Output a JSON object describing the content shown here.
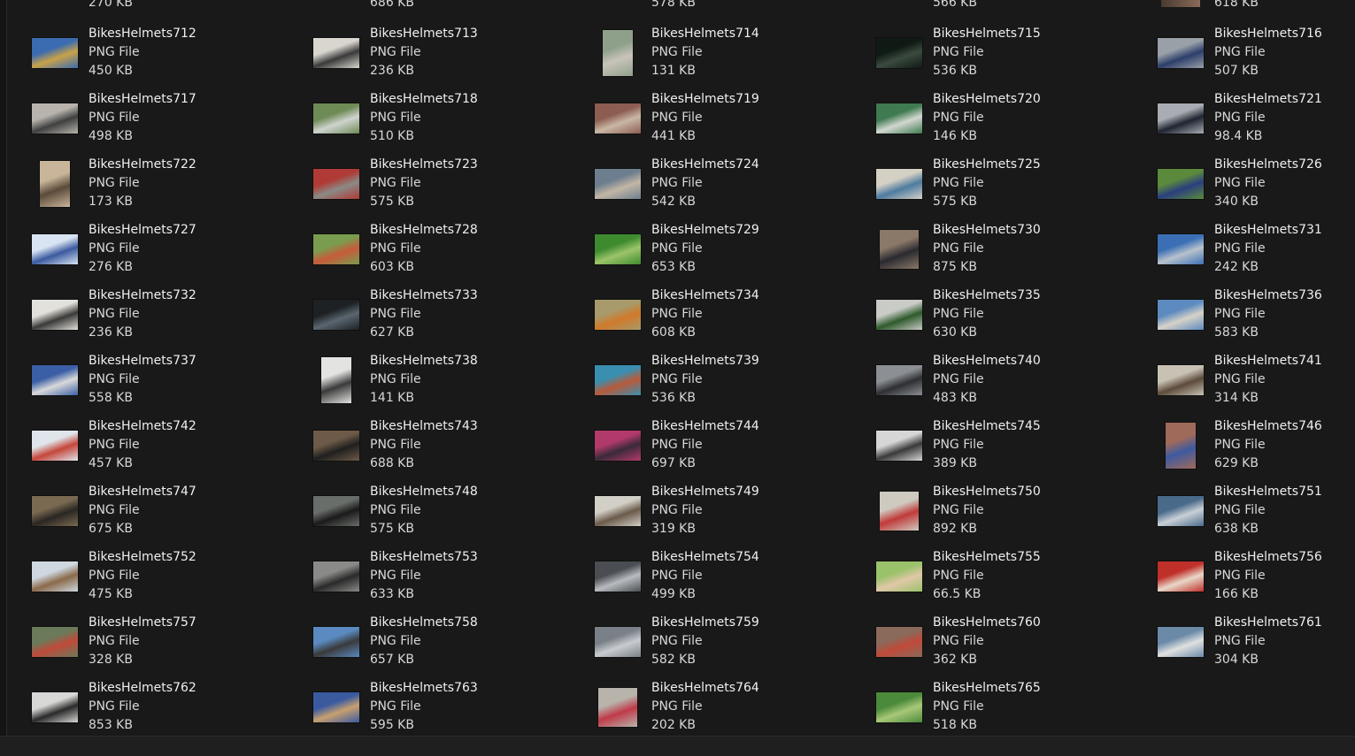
{
  "partial_row": [
    "270 KB",
    "686 KB",
    "578 KB",
    "566 KB",
    "618 KB"
  ],
  "file_type": "PNG File",
  "files": [
    {
      "name": "BikesHelmets712",
      "size": "450 KB",
      "shape": "land",
      "colors": [
        "#3b6bb0",
        "#c8a24a"
      ]
    },
    {
      "name": "BikesHelmets713",
      "size": "236 KB",
      "shape": "land",
      "colors": [
        "#d9d6cf",
        "#3a3a3a"
      ]
    },
    {
      "name": "BikesHelmets714",
      "size": "131 KB",
      "shape": "port",
      "colors": [
        "#8fa08a",
        "#c9c4bb"
      ]
    },
    {
      "name": "BikesHelmets715",
      "size": "536 KB",
      "shape": "land",
      "colors": [
        "#0f1a14",
        "#3b4a3e"
      ]
    },
    {
      "name": "BikesHelmets716",
      "size": "507 KB",
      "shape": "land",
      "colors": [
        "#9aa0a8",
        "#2c3e6a"
      ]
    },
    {
      "name": "BikesHelmets717",
      "size": "498 KB",
      "shape": "land",
      "colors": [
        "#b8b4ad",
        "#3f4040"
      ]
    },
    {
      "name": "BikesHelmets718",
      "size": "510 KB",
      "shape": "land",
      "colors": [
        "#6e8a55",
        "#cfd3cf"
      ]
    },
    {
      "name": "BikesHelmets719",
      "size": "441 KB",
      "shape": "land",
      "colors": [
        "#8d5c52",
        "#c9b7a4"
      ]
    },
    {
      "name": "BikesHelmets720",
      "size": "146 KB",
      "shape": "land",
      "colors": [
        "#3f7a50",
        "#d2d7d0"
      ]
    },
    {
      "name": "BikesHelmets721",
      "size": "98.4 KB",
      "shape": "land",
      "colors": [
        "#a9adb3",
        "#1e2430"
      ]
    },
    {
      "name": "BikesHelmets722",
      "size": "173 KB",
      "shape": "port",
      "colors": [
        "#c9b59a",
        "#5a4a3a"
      ]
    },
    {
      "name": "BikesHelmets723",
      "size": "575 KB",
      "shape": "land",
      "colors": [
        "#b03a35",
        "#8a8a86"
      ]
    },
    {
      "name": "BikesHelmets724",
      "size": "542 KB",
      "shape": "land",
      "colors": [
        "#6d7f8e",
        "#c3b6a5"
      ]
    },
    {
      "name": "BikesHelmets725",
      "size": "575 KB",
      "shape": "land",
      "colors": [
        "#d5d0c4",
        "#4d7ba0"
      ]
    },
    {
      "name": "BikesHelmets726",
      "size": "340 KB",
      "shape": "land",
      "colors": [
        "#5c8a3c",
        "#2a3f7e"
      ]
    },
    {
      "name": "BikesHelmets727",
      "size": "276 KB",
      "shape": "land",
      "colors": [
        "#d9e4f2",
        "#3b5aa0"
      ]
    },
    {
      "name": "BikesHelmets728",
      "size": "603 KB",
      "shape": "land",
      "colors": [
        "#7a9c4e",
        "#c75b3a"
      ]
    },
    {
      "name": "BikesHelmets729",
      "size": "653 KB",
      "shape": "land",
      "colors": [
        "#3e8a2f",
        "#9cc46a"
      ]
    },
    {
      "name": "BikesHelmets730",
      "size": "875 KB",
      "shape": "sq",
      "colors": [
        "#8a7868",
        "#2a2a30"
      ]
    },
    {
      "name": "BikesHelmets731",
      "size": "242 KB",
      "shape": "land",
      "colors": [
        "#3b6fb5",
        "#b8c2cc"
      ]
    },
    {
      "name": "BikesHelmets732",
      "size": "236 KB",
      "shape": "land",
      "colors": [
        "#e3e1dc",
        "#3a3a38"
      ]
    },
    {
      "name": "BikesHelmets733",
      "size": "627 KB",
      "shape": "land",
      "colors": [
        "#1d2124",
        "#5a6670"
      ]
    },
    {
      "name": "BikesHelmets734",
      "size": "608 KB",
      "shape": "land",
      "colors": [
        "#a89a6a",
        "#d07a2a"
      ]
    },
    {
      "name": "BikesHelmets735",
      "size": "630 KB",
      "shape": "land",
      "colors": [
        "#c9cbc6",
        "#2e5a2c"
      ]
    },
    {
      "name": "BikesHelmets736",
      "size": "583 KB",
      "shape": "land",
      "colors": [
        "#5d8bc0",
        "#d6d2c8"
      ]
    },
    {
      "name": "BikesHelmets737",
      "size": "558 KB",
      "shape": "land",
      "colors": [
        "#3b5fa6",
        "#d9d9d9"
      ]
    },
    {
      "name": "BikesHelmets738",
      "size": "141 KB",
      "shape": "port",
      "colors": [
        "#e3e3e1",
        "#3a3a3a"
      ]
    },
    {
      "name": "BikesHelmets739",
      "size": "536 KB",
      "shape": "land",
      "colors": [
        "#3a8fb0",
        "#b85a3a"
      ]
    },
    {
      "name": "BikesHelmets740",
      "size": "483 KB",
      "shape": "land",
      "colors": [
        "#8c8f93",
        "#2d2f33"
      ]
    },
    {
      "name": "BikesHelmets741",
      "size": "314 KB",
      "shape": "land",
      "colors": [
        "#c8c2b5",
        "#5d4b3b"
      ]
    },
    {
      "name": "BikesHelmets742",
      "size": "457 KB",
      "shape": "land",
      "colors": [
        "#dfe5ea",
        "#c5463b"
      ]
    },
    {
      "name": "BikesHelmets743",
      "size": "688 KB",
      "shape": "land",
      "colors": [
        "#6e5a48",
        "#1f1f1f"
      ]
    },
    {
      "name": "BikesHelmets744",
      "size": "697 KB",
      "shape": "land",
      "colors": [
        "#b23a6a",
        "#3a2a3a"
      ]
    },
    {
      "name": "BikesHelmets745",
      "size": "389 KB",
      "shape": "land",
      "colors": [
        "#d6d6d6",
        "#3a3a3a"
      ]
    },
    {
      "name": "BikesHelmets746",
      "size": "629 KB",
      "shape": "port",
      "colors": [
        "#a06a5a",
        "#3d5aa0"
      ]
    },
    {
      "name": "BikesHelmets747",
      "size": "675 KB",
      "shape": "land",
      "colors": [
        "#7a6a52",
        "#2a2622"
      ]
    },
    {
      "name": "BikesHelmets748",
      "size": "575 KB",
      "shape": "land",
      "colors": [
        "#6a6e6a",
        "#1a1a1a"
      ]
    },
    {
      "name": "BikesHelmets749",
      "size": "319 KB",
      "shape": "land",
      "colors": [
        "#d2cfc6",
        "#6a5a4a"
      ]
    },
    {
      "name": "BikesHelmets750",
      "size": "892 KB",
      "shape": "sq",
      "colors": [
        "#cfcac0",
        "#c03a3a"
      ]
    },
    {
      "name": "BikesHelmets751",
      "size": "638 KB",
      "shape": "land",
      "colors": [
        "#4a6a8a",
        "#c9d0d6"
      ]
    },
    {
      "name": "BikesHelmets752",
      "size": "475 KB",
      "shape": "land",
      "colors": [
        "#cfd8e0",
        "#8a6a4a"
      ]
    },
    {
      "name": "BikesHelmets753",
      "size": "633 KB",
      "shape": "land",
      "colors": [
        "#8a8a88",
        "#2a2a2a"
      ]
    },
    {
      "name": "BikesHelmets754",
      "size": "499 KB",
      "shape": "land",
      "colors": [
        "#4a4e52",
        "#b8bcc0"
      ]
    },
    {
      "name": "BikesHelmets755",
      "size": "66.5 KB",
      "shape": "land",
      "colors": [
        "#9ac26a",
        "#e0c8a8"
      ]
    },
    {
      "name": "BikesHelmets756",
      "size": "166 KB",
      "shape": "land",
      "colors": [
        "#c0302a",
        "#e8d8c8"
      ]
    },
    {
      "name": "BikesHelmets757",
      "size": "328 KB",
      "shape": "land",
      "colors": [
        "#6a7a5a",
        "#c04a3a"
      ]
    },
    {
      "name": "BikesHelmets758",
      "size": "657 KB",
      "shape": "land",
      "colors": [
        "#5a8ac0",
        "#3a3a3a"
      ]
    },
    {
      "name": "BikesHelmets759",
      "size": "582 KB",
      "shape": "land",
      "colors": [
        "#7a8088",
        "#c8ccd0"
      ]
    },
    {
      "name": "BikesHelmets760",
      "size": "362 KB",
      "shape": "land",
      "colors": [
        "#8a6a5a",
        "#c04a3a"
      ]
    },
    {
      "name": "BikesHelmets761",
      "size": "304 KB",
      "shape": "land",
      "colors": [
        "#6a8aa8",
        "#e0e0e0"
      ]
    },
    {
      "name": "BikesHelmets762",
      "size": "853 KB",
      "shape": "land",
      "colors": [
        "#d8d8d6",
        "#2a2a2a"
      ]
    },
    {
      "name": "BikesHelmets763",
      "size": "595 KB",
      "shape": "land",
      "colors": [
        "#3a5aa0",
        "#c8a070"
      ]
    },
    {
      "name": "BikesHelmets764",
      "size": "202 KB",
      "shape": "sq",
      "colors": [
        "#b8b4ac",
        "#c03a4a"
      ]
    },
    {
      "name": "BikesHelmets765",
      "size": "518 KB",
      "shape": "land",
      "colors": [
        "#4a8a3a",
        "#a8c878"
      ]
    }
  ]
}
